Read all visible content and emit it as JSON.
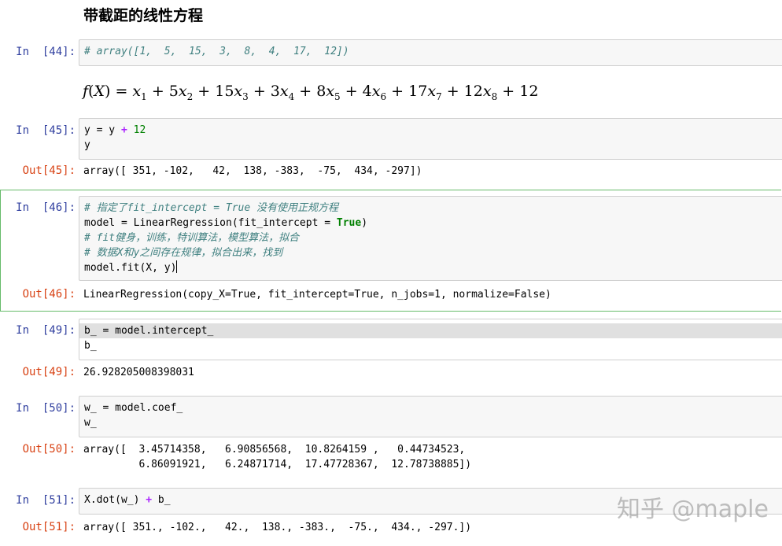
{
  "heading": "带截距的线性方程",
  "cells": [
    {
      "in_prompt": "In  [44]:",
      "source": [
        "# array([1,  5,  15,  3,  8,  4,  17,  12])"
      ]
    },
    {
      "formula": "f(X) = x1 + 5x2 + 15x3 + 3x4 + 8x5 + 4x6 + 17x7 + 12x8 + 12"
    },
    {
      "in_prompt": "In  [45]:",
      "source": [
        "y = y + 12",
        "y"
      ],
      "out_prompt": "Out[45]:",
      "output": [
        "array([ 351, -102,   42,  138, -383,  -75,  434, -297])"
      ]
    },
    {
      "in_prompt": "In  [46]:",
      "source": [
        "# 指定了fit_intercept = True 没有使用正规方程",
        "model = LinearRegression(fit_intercept = True)",
        "# fit健身，训练，特训算法，模型算法，拟合",
        "# 数据X和y之间存在规律，拟合出来，找到",
        "model.fit(X, y)"
      ],
      "out_prompt": "Out[46]:",
      "output": [
        "LinearRegression(copy_X=True, fit_intercept=True, n_jobs=1, normalize=False)"
      ],
      "selected": true
    },
    {
      "in_prompt": "In  [49]:",
      "source": [
        "b_ = model.intercept_",
        "b_"
      ],
      "out_prompt": "Out[49]:",
      "output": [
        "26.928205008398031"
      ]
    },
    {
      "in_prompt": "In  [50]:",
      "source": [
        "w_ = model.coef_",
        "w_"
      ],
      "out_prompt": "Out[50]:",
      "output": [
        "array([  3.45714358,   6.90856568,  10.8264159 ,   0.44734523,",
        "         6.86091921,   6.24871714,  17.47728367,  12.78738885])"
      ]
    },
    {
      "in_prompt": "In  [51]:",
      "source": [
        "X.dot(w_) + b_"
      ],
      "out_prompt": "Out[51]:",
      "output": [
        "array([ 351., -102.,   42.,  138., -383.,  -75.,  434., -297.])"
      ]
    }
  ],
  "watermark": "知乎 @maple",
  "colors": {
    "in_prompt": "#303F9F",
    "out_prompt": "#D84315",
    "comment": "#408080",
    "number": "#008000",
    "keyword": "#008000",
    "operator": "#AA22FF",
    "selected_border": "#66bb6a"
  }
}
